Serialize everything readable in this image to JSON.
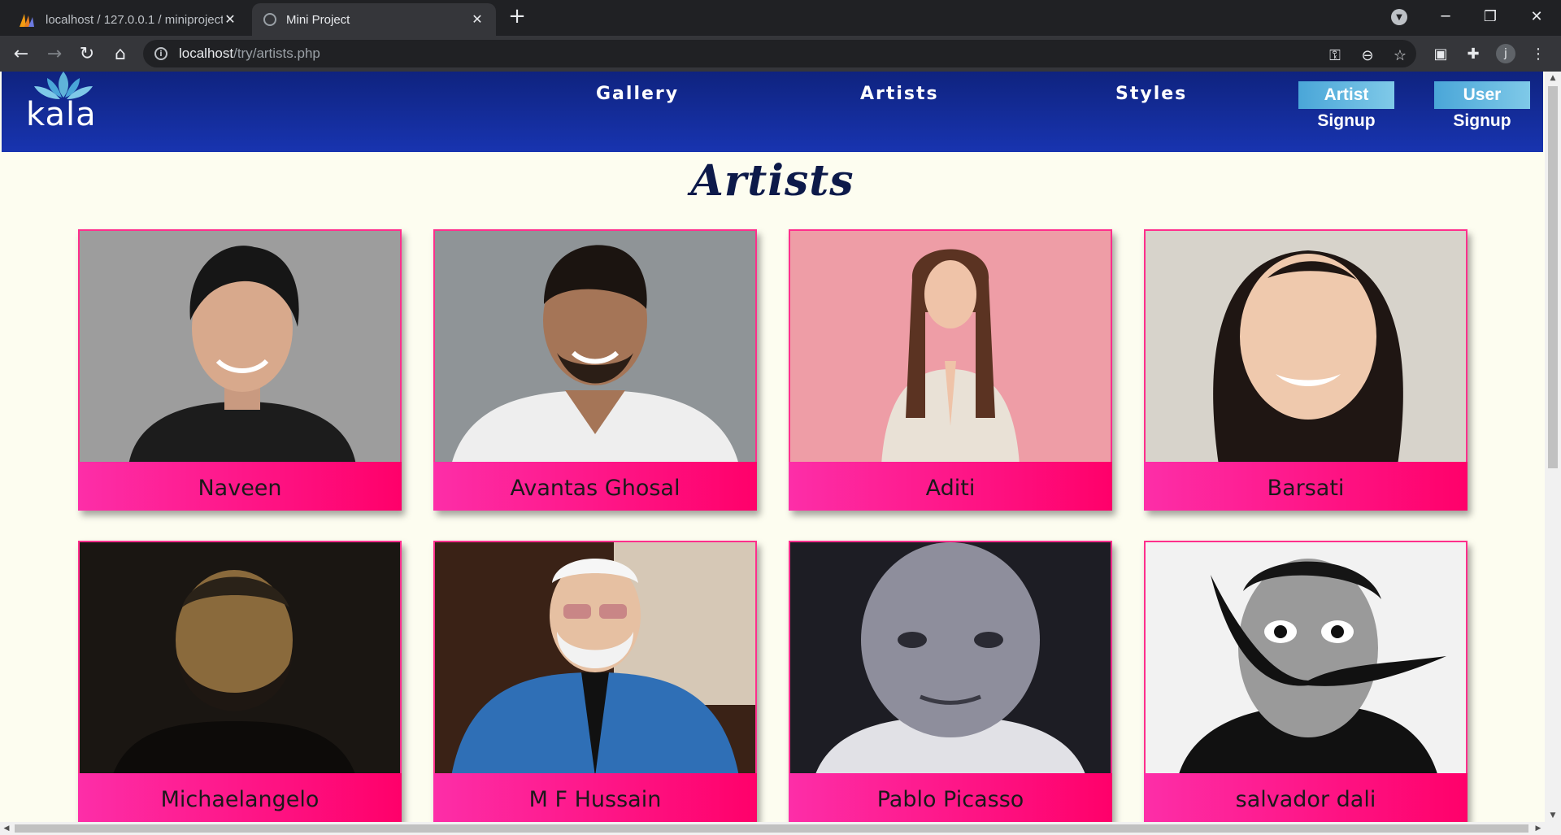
{
  "browser": {
    "tabs": [
      {
        "title": "localhost / 127.0.0.1 / miniproject",
        "active": false
      },
      {
        "title": "Mini Project",
        "active": true
      }
    ],
    "address": {
      "host": "localhost",
      "path": "/try/artists.php"
    }
  },
  "site": {
    "logo_text": "kala",
    "nav": [
      "Gallery",
      "Artists",
      "Styles"
    ],
    "signup_buttons": [
      {
        "top": "Artist",
        "bottom": "Signup"
      },
      {
        "top": "User",
        "bottom": "Signup"
      }
    ],
    "page_title": "Artists"
  },
  "artists": [
    {
      "name": "Naveen"
    },
    {
      "name": "Avantas Ghosal"
    },
    {
      "name": "Aditi"
    },
    {
      "name": "Barsati"
    },
    {
      "name": "Michaelangelo"
    },
    {
      "name": "M F Hussain"
    },
    {
      "name": "Pablo Picasso"
    },
    {
      "name": "salvador dali"
    }
  ],
  "colors": {
    "header_gradient": [
      "#0f237f",
      "#1834b0"
    ],
    "card_label_gradient": [
      "#fd2ea8",
      "#ff006a"
    ],
    "page_background": "#fdfdf0"
  }
}
